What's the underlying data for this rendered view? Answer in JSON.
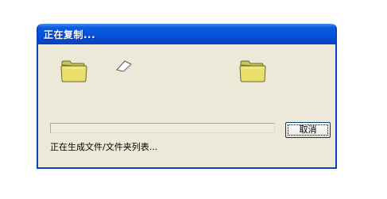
{
  "window": {
    "title": "正在复制..."
  },
  "progress": {
    "fraction": 0
  },
  "buttons": {
    "cancel_label": "取消"
  },
  "status": {
    "text": "正在生成文件/文件夹列表..."
  },
  "icons": {
    "source": "folder-icon",
    "flying": "document-icon",
    "destination": "folder-icon"
  },
  "colors": {
    "titlebar": "#0553dc",
    "window_bg": "#ece9d8",
    "folder": "#e8e06a"
  }
}
